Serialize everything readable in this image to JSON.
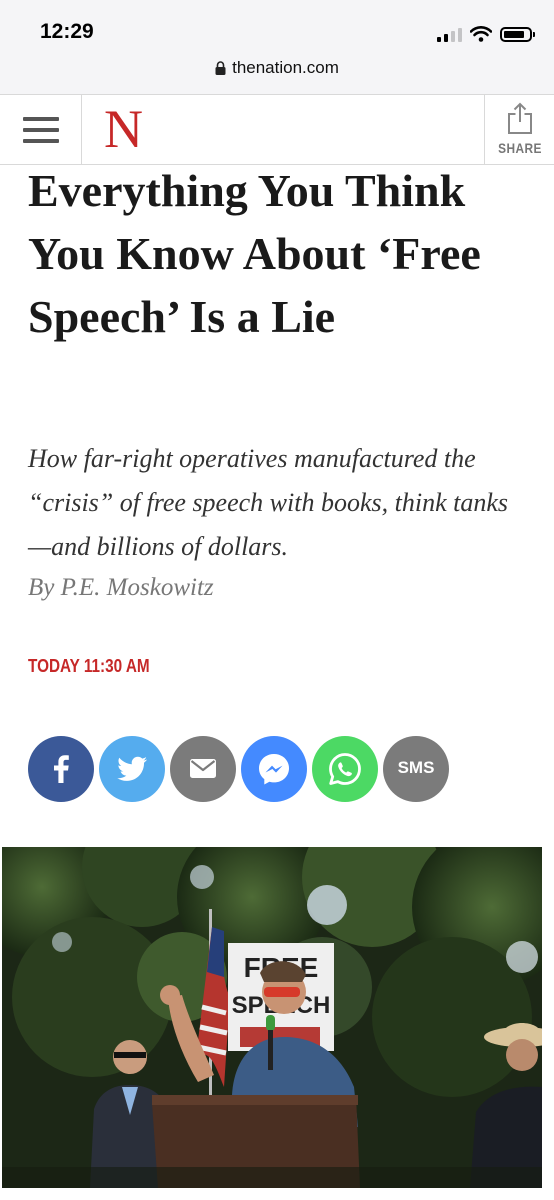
{
  "status_bar": {
    "time": "12:29"
  },
  "browser": {
    "url": "thenation.com"
  },
  "header": {
    "logo": "N",
    "share_label": "SHARE"
  },
  "article": {
    "headline": "Everything You Think You Know About ‘Free Speech’ Is a Lie",
    "dek": "How far-right operatives manufactured the “crisis” of free speech with books, think tanks—and billions of dollars.",
    "byline": "By P.E. Moskowitz",
    "dateline": "TODAY 11:30 AM"
  },
  "share_buttons": [
    {
      "network": "facebook",
      "icon": "facebook-icon",
      "color": "#3b5998"
    },
    {
      "network": "twitter",
      "icon": "twitter-icon",
      "color": "#55acee"
    },
    {
      "network": "email",
      "icon": "envelope-icon",
      "color": "#7b7b7b"
    },
    {
      "network": "messenger",
      "icon": "messenger-icon",
      "color": "#448aff"
    },
    {
      "network": "whatsapp",
      "icon": "whatsapp-icon",
      "color": "#4cd964"
    },
    {
      "network": "sms",
      "label": "SMS",
      "color": "#7b7b7b"
    }
  ],
  "hero_image": {
    "sign_text_lines": [
      "FREE",
      "SPEECH"
    ]
  }
}
